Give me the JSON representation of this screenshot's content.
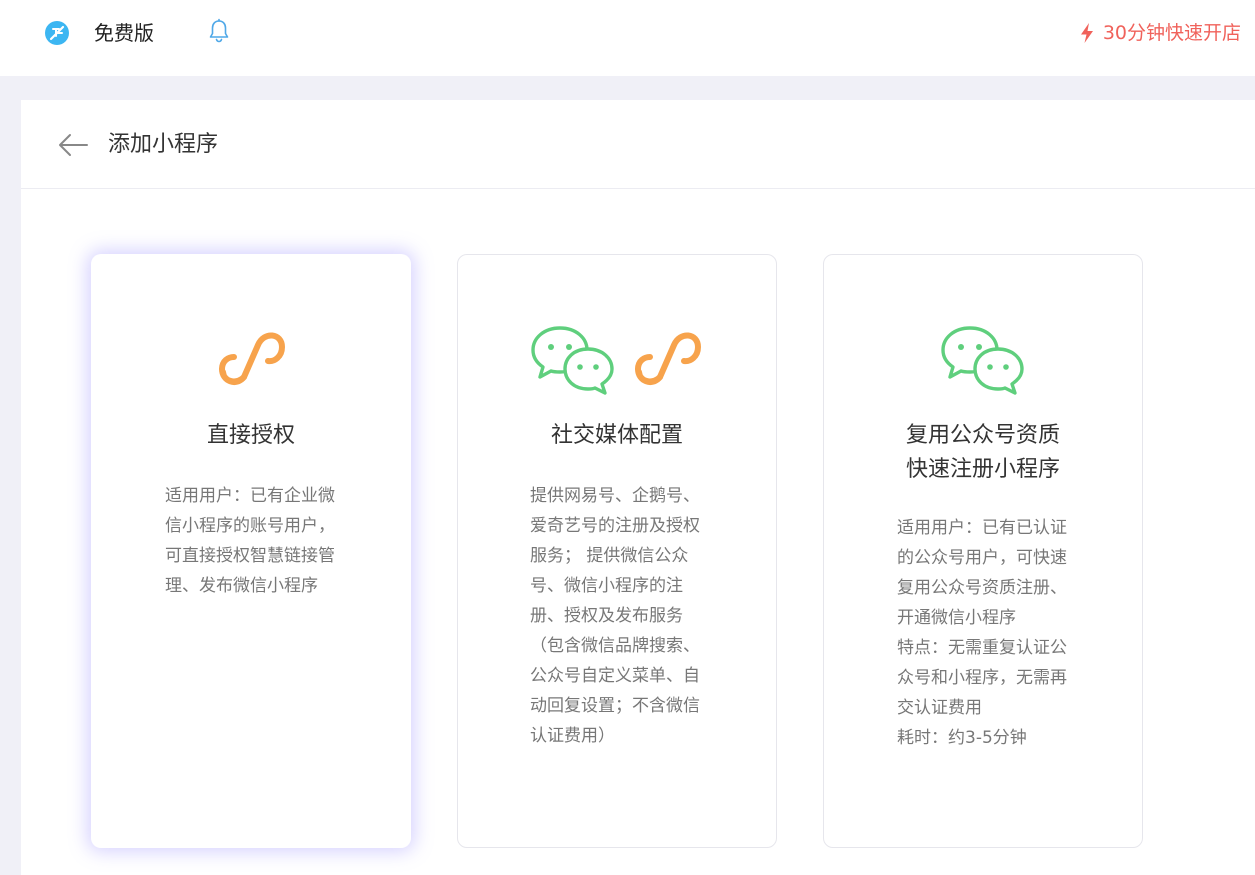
{
  "topbar": {
    "logo_icon": "brand-logo-icon",
    "edition_label": "免费版",
    "bell_icon": "bell-icon",
    "promo_label": "30分钟快速开店",
    "promo_icon": "lightning-icon",
    "promo_color": "#f0625b"
  },
  "panel": {
    "back_icon": "arrow-left-icon",
    "title": "添加小程序"
  },
  "cards": [
    {
      "title": "直接授权",
      "description": "适用用户：已有企业微\n信小程序的账号用户，\n可直接授权智慧链接管\n理、发布微信小程序",
      "icons": [
        "mini-program-icon"
      ],
      "selected": true
    },
    {
      "title": "社交媒体配置",
      "description": "提供网易号、企鹅号、\n爱奇艺号的注册及授权\n服务； 提供微信公众\n号、微信小程序的注\n册、授权及发布服务\n（包含微信品牌搜索、\n公众号自定义菜单、自\n动回复设置；不含微信\n认证费用）",
      "icons": [
        "wechat-icon",
        "mini-program-icon"
      ],
      "selected": false
    },
    {
      "title": "复用公众号资质\n快速注册小程序",
      "title_line1": "复用公众号资质",
      "title_line2": "快速注册小程序",
      "description": "适用用户：已有已认证\n的公众号用户，可快速\n复用公众号资质注册、\n开通微信小程序\n特点：无需重复认证公\n众号和小程序，无需再\n交认证费用\n耗时：约3-5分钟",
      "icons": [
        "wechat-icon"
      ],
      "selected": false
    }
  ],
  "colors": {
    "accent_orange": "#f7a34c",
    "wechat_green": "#5fcf7d",
    "logo_blue": "#3cb6f2",
    "selected_glow": "#8c82ff"
  }
}
